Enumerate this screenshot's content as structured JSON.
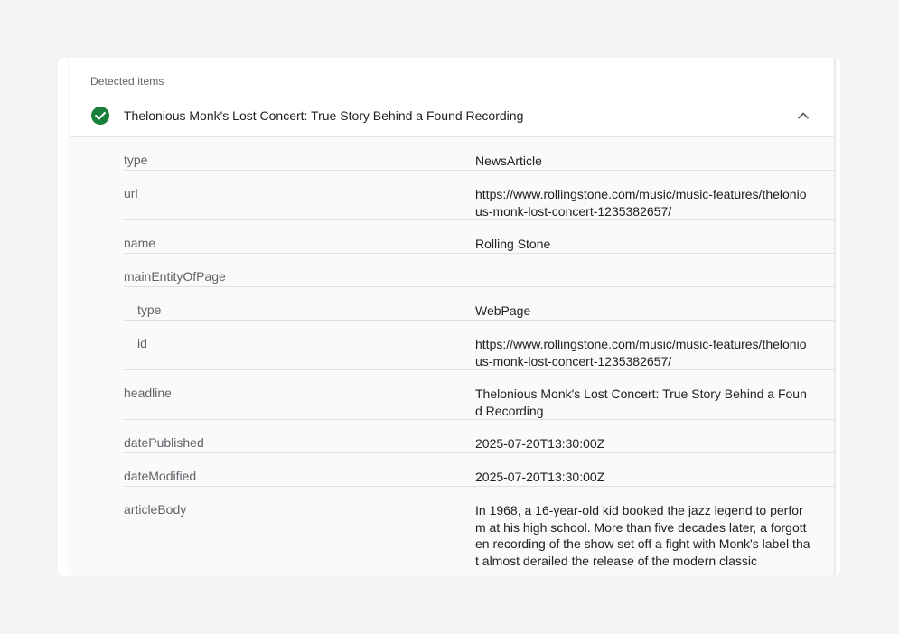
{
  "section": {
    "label": "Detected items"
  },
  "item": {
    "title": "Thelonious Monk's Lost Concert: True Story Behind a Found Recording",
    "status_icon": "check-circle-icon",
    "collapse_icon": "chevron-up-icon",
    "status_color": "#188038"
  },
  "rows": [
    {
      "key": "type",
      "value": "NewsArticle"
    },
    {
      "key": "url",
      "value": "https://www.rollingstone.com/music/music-features/thelonious-monk-lost-concert-1235382657/"
    },
    {
      "key": "name",
      "value": "Rolling Stone"
    },
    {
      "key": "mainEntityOfPage",
      "value": ""
    },
    {
      "key": "type",
      "value": "WebPage"
    },
    {
      "key": "id",
      "value": "https://www.rollingstone.com/music/music-features/thelonious-monk-lost-concert-1235382657/"
    },
    {
      "key": "headline",
      "value": "Thelonious Monk's Lost Concert: True Story Behind a Found Recording"
    },
    {
      "key": "datePublished",
      "value": "2025-07-20T13:30:00Z"
    },
    {
      "key": "dateModified",
      "value": "2025-07-20T13:30:00Z"
    },
    {
      "key": "articleBody",
      "value": "In 1968, a 16-year-old kid booked the jazz legend to perform at his high school. More than five decades later, a forgotten recording of the show set off a fight with Monk's label that almost derailed the release of the modern classic"
    }
  ]
}
